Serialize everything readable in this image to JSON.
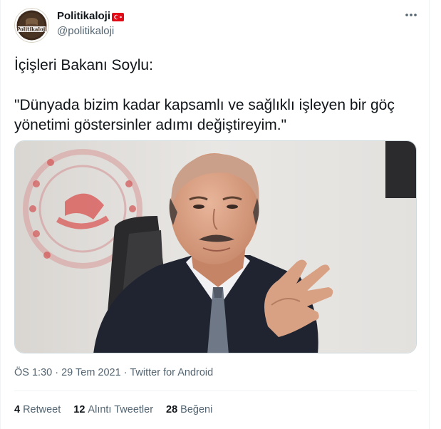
{
  "user": {
    "display_name": "Politikaloji",
    "handle": "@politikaloji",
    "avatar_text": "Politikaloji"
  },
  "tweet": {
    "text": "İçişleri Bakanı Soylu:\n\n\"Dünyada bizim kadar kapsamlı ve sağlıklı işleyen bir göç yönetimi göstersinler adımı değiştireyim.\""
  },
  "meta": {
    "time": "ÖS 1:30",
    "date": "29 Tem 2021",
    "separator": "·",
    "source": "Twitter for Android"
  },
  "stats": [
    {
      "count": "4",
      "label": "Retweet"
    },
    {
      "count": "12",
      "label": "Alıntı Tweetler"
    },
    {
      "count": "28",
      "label": "Beğeni"
    }
  ],
  "colors": {
    "text_primary": "#0f1419",
    "text_secondary": "#536471",
    "border": "#eff3f4",
    "flag_red": "#e30a17"
  },
  "icons": {
    "more": "more-dots-icon",
    "flag": "turkey-flag-icon"
  }
}
